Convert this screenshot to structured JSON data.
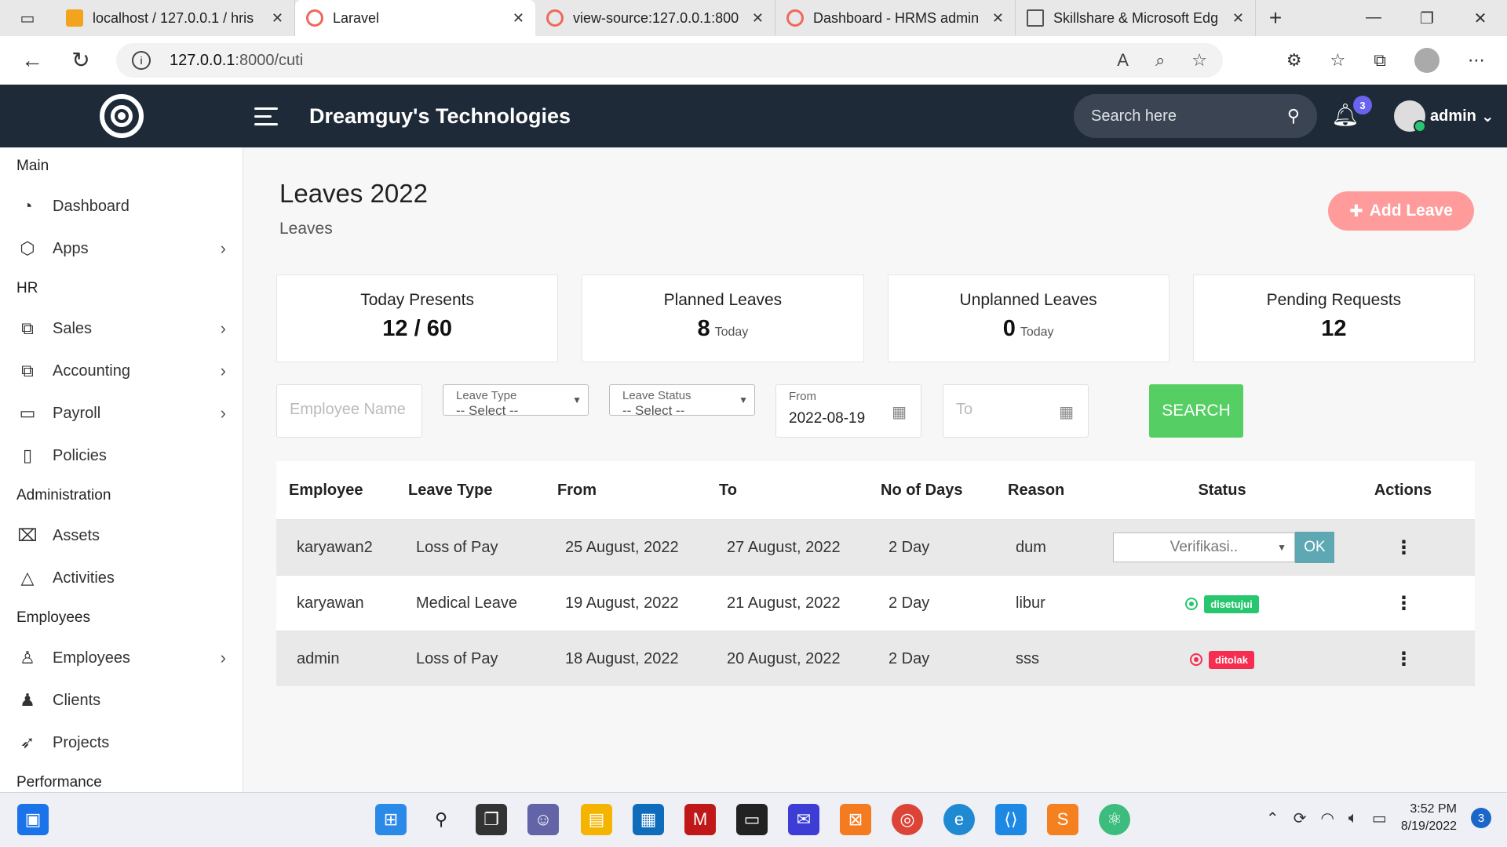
{
  "browser": {
    "tabs": [
      {
        "title": "localhost / 127.0.0.1 / hris",
        "color": "#f2a41c"
      },
      {
        "title": "Laravel",
        "color": "#f0685a"
      },
      {
        "title": "view-source:127.0.0.1:800",
        "color": "#f0685a"
      },
      {
        "title": "Dashboard - HRMS admin",
        "color": "#f0685a"
      },
      {
        "title": "Skillshare & Microsoft Edg",
        "color": "#888888"
      }
    ],
    "url_host": "127.0.0.1",
    "url_path": ":8000/cuti"
  },
  "header": {
    "company": "Dreamguy's Technologies",
    "search_placeholder": "Search here",
    "notifications": "3",
    "user": "admin"
  },
  "sidebar": {
    "main_label": "Main",
    "dashboard": "Dashboard",
    "apps": "Apps",
    "hr_label": "HR",
    "sales": "Sales",
    "accounting": "Accounting",
    "payroll": "Payroll",
    "policies": "Policies",
    "admin_label": "Administration",
    "assets": "Assets",
    "activities": "Activities",
    "employees_label": "Employees",
    "employees": "Employees",
    "clients": "Clients",
    "projects": "Projects",
    "performance_label": "Performance"
  },
  "page": {
    "title": "Leaves 2022",
    "subtitle": "Leaves",
    "add_button": "Add Leave"
  },
  "stats": [
    {
      "label": "Today Presents",
      "value": "12 / 60",
      "suffix": ""
    },
    {
      "label": "Planned Leaves",
      "value": "8",
      "suffix": "Today"
    },
    {
      "label": "Unplanned Leaves",
      "value": "0",
      "suffix": "Today"
    },
    {
      "label": "Pending Requests",
      "value": "12",
      "suffix": ""
    }
  ],
  "filters": {
    "employee_placeholder": "Employee Name",
    "leave_type_label": "Leave Type",
    "leave_type_value": "-- Select --",
    "leave_status_label": "Leave Status",
    "leave_status_value": "-- Select --",
    "from_label": "From",
    "from_value": "2022-08-19",
    "to_placeholder": "To",
    "search_button": "SEARCH"
  },
  "table": {
    "headers": [
      "Employee",
      "Leave Type",
      "From",
      "To",
      "No of Days",
      "Reason",
      "Status",
      "Actions"
    ],
    "rows": [
      {
        "employee": "karyawan2",
        "type": "Loss of Pay",
        "from": "25 August, 2022",
        "to": "27 August, 2022",
        "days": "2 Day",
        "reason": "dum",
        "status": "Verifikasi..",
        "ok": "OK"
      },
      {
        "employee": "karyawan",
        "type": "Medical Leave",
        "from": "19 August, 2022",
        "to": "21 August, 2022",
        "days": "2 Day",
        "reason": "libur",
        "status": "disetujui",
        "status_color": "#28c76f"
      },
      {
        "employee": "admin",
        "type": "Loss of Pay",
        "from": "18 August, 2022",
        "to": "20 August, 2022",
        "days": "2 Day",
        "reason": "sss",
        "status": "ditolak",
        "status_color": "#f62d51"
      }
    ]
  },
  "taskbar": {
    "time": "3:52 PM",
    "date": "8/19/2022",
    "notif": "3"
  }
}
